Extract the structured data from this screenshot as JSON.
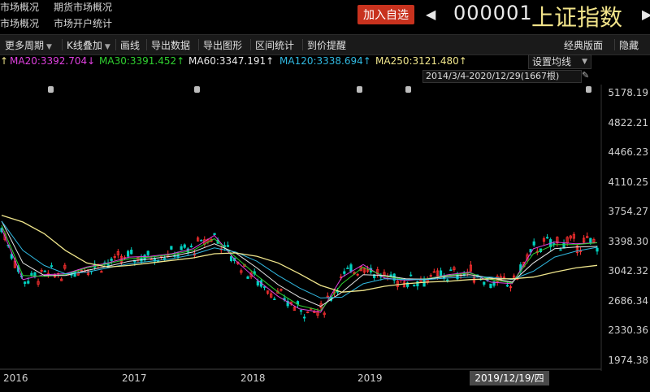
{
  "nav": {
    "item1": "市场概况",
    "item2": "期货市场概况",
    "item3": "市场概况",
    "item4": "市场开户统计"
  },
  "header": {
    "add_label": "加入自选",
    "code": "000001",
    "name": "上证指数"
  },
  "toolbar": {
    "items": [
      "更多周期",
      "K线叠加",
      "画线",
      "导出数据",
      "导出图形",
      "区间统计",
      "到价提醒"
    ],
    "right_items": [
      "经典版面",
      "隐藏"
    ]
  },
  "ma": {
    "ma20": "MA20:3392.704↓",
    "ma30": "MA30:3391.452↑",
    "ma60": "MA60:3347.191↑",
    "ma120": "MA120:3338.694↑",
    "ma250": "MA250:3121.480↑",
    "lead_arrow": "↑",
    "set_label": "设置均线",
    "range_label": "2014/3/4-2020/12/29(1667根)"
  },
  "colors": {
    "ma20": "#e040e0",
    "ma30": "#30d030",
    "ma60": "#e8e8e8",
    "ma120": "#30b8e0",
    "ma250": "#f0e68c",
    "up": "#ff3030",
    "down": "#00d0c0",
    "accent": "#c8321e"
  },
  "chart_data": {
    "type": "line",
    "title": "",
    "y_ticks": [
      "5178.19",
      "4822.21",
      "4466.23",
      "4110.25",
      "3754.27",
      "3398.30",
      "3042.32",
      "2686.34",
      "2330.36",
      "1974.38"
    ],
    "x_ticks": [
      "2016",
      "2017",
      "2018",
      "2019"
    ],
    "cursor_date": "2019/12/19/四",
    "ylim": [
      1974.38,
      5178.19
    ],
    "series": [
      {
        "name": "MA20",
        "values": [
          3560,
          2950,
          3010,
          3020,
          3100,
          3150,
          3220,
          3230,
          3260,
          3320,
          3480,
          3180,
          2950,
          2750,
          2600,
          2560,
          2980,
          3130,
          2970,
          2940,
          2960,
          3010,
          3040,
          2920,
          2900,
          3320,
          3400,
          3380,
          3392
        ]
      },
      {
        "name": "MA30",
        "values": [
          3600,
          3000,
          2990,
          3010,
          3090,
          3140,
          3200,
          3220,
          3250,
          3300,
          3440,
          3220,
          3000,
          2800,
          2640,
          2580,
          2900,
          3100,
          2990,
          2950,
          2960,
          3000,
          3030,
          2950,
          2910,
          3260,
          3370,
          3370,
          3391
        ]
      },
      {
        "name": "MA60",
        "values": [
          3650,
          3150,
          3000,
          3000,
          3060,
          3110,
          3170,
          3200,
          3230,
          3280,
          3380,
          3270,
          3090,
          2890,
          2740,
          2630,
          2800,
          3010,
          3000,
          2960,
          2955,
          2990,
          3010,
          2970,
          2920,
          3150,
          3320,
          3340,
          3347
        ]
      },
      {
        "name": "MA120",
        "values": [
          3650,
          3300,
          3120,
          3020,
          3040,
          3090,
          3140,
          3170,
          3200,
          3250,
          3330,
          3280,
          3170,
          3000,
          2850,
          2730,
          2740,
          2900,
          2960,
          2950,
          2950,
          2970,
          2980,
          2980,
          2950,
          3050,
          3220,
          3290,
          3338
        ]
      },
      {
        "name": "MA250",
        "values": [
          3720,
          3640,
          3500,
          3300,
          3150,
          3100,
          3120,
          3150,
          3180,
          3210,
          3260,
          3270,
          3230,
          3150,
          3020,
          2880,
          2800,
          2820,
          2870,
          2900,
          2920,
          2930,
          2950,
          2960,
          2960,
          2980,
          3040,
          3090,
          3121
        ]
      }
    ]
  }
}
